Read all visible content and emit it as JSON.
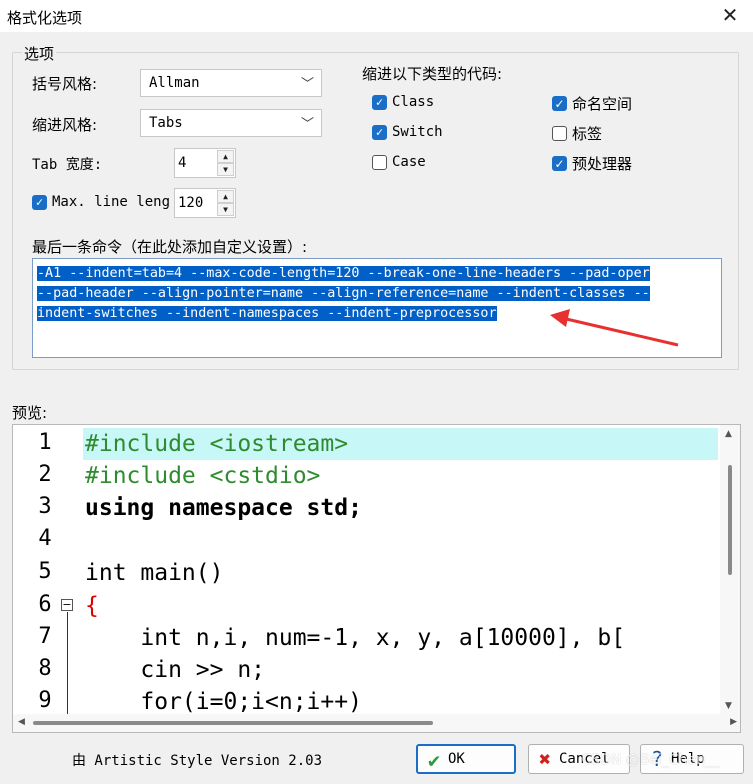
{
  "window": {
    "title": "格式化选项",
    "close_glyph": "✕"
  },
  "options": {
    "legend": "选项",
    "bracket_style_label": "括号风格:",
    "bracket_style_value": "Allman",
    "indent_style_label": "缩进风格:",
    "indent_style_value": "Tabs",
    "tab_width_label": "Tab 宽度:",
    "tab_width_value": "4",
    "max_line_label": "Max. line leng",
    "max_line_checked": true,
    "max_line_value": "120",
    "indent_types_label": "缩进以下类型的代码:",
    "indent_types": [
      {
        "label": "Class",
        "checked": true
      },
      {
        "label": "Switch",
        "checked": true
      },
      {
        "label": "Case",
        "checked": false
      },
      {
        "label": "命名空间",
        "checked": true
      },
      {
        "label": "标签",
        "checked": false
      },
      {
        "label": "预处理器",
        "checked": true
      }
    ],
    "last_command_label": "最后一条命令（在此处添加自定义设置）:",
    "last_command_lines": [
      "-A1 --indent=tab=4 --max-code-length=120 --break-one-line-headers --pad-oper ",
      "--pad-header --align-pointer=name --align-reference=name --indent-classes --",
      "indent-switches --indent-namespaces --indent-preprocessor"
    ]
  },
  "preview": {
    "label": "预览:",
    "line_numbers": [
      "1",
      "2",
      "3",
      "4",
      "5",
      "6",
      "7",
      "8",
      "9"
    ],
    "code_lines": [
      "#include <iostream>",
      "#include <cstdio>",
      "using namespace std;",
      "",
      "int main()",
      "{",
      "    int n,i, num=-1, x, y, a[10000], b[",
      "    cin >> n;",
      "    for(i=0;i<n;i++)"
    ]
  },
  "footer": {
    "version": "由 Artistic Style Version 2.03",
    "ok_label": "OK",
    "cancel_label": "Cancel",
    "help_label": "Help",
    "watermark": "CSDN @Bei_Chen__"
  },
  "colors": {
    "accent": "#1a6ec7",
    "selection": "#0060c8",
    "current_line": "#c8f7f7",
    "arrow": "#e83030"
  }
}
